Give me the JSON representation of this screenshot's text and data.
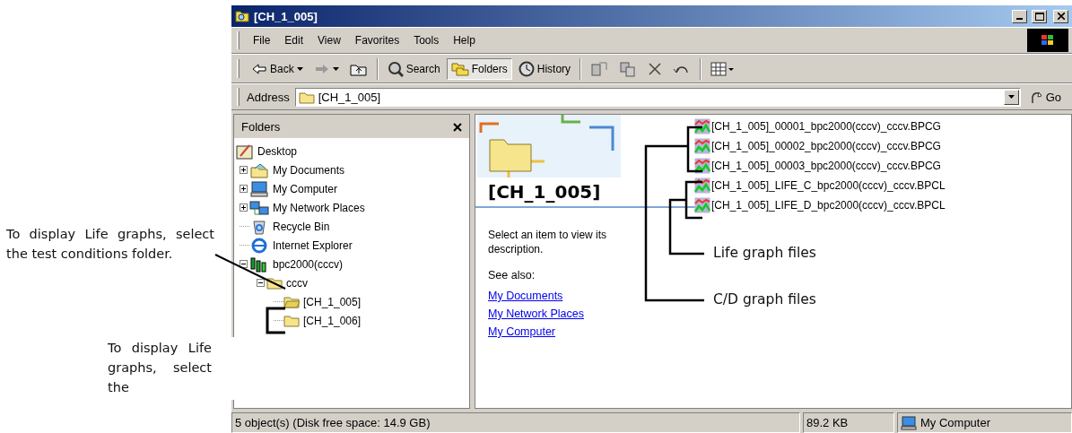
{
  "annotations": {
    "top_note": "To display Life graphs, select the test conditions folder.",
    "lower_note": "To display Life graphs, select the",
    "life_label": "Life graph files",
    "cd_label": "C/D graph files"
  },
  "window": {
    "title": "[CH_1_005]"
  },
  "menu": [
    "File",
    "Edit",
    "View",
    "Favorites",
    "Tools",
    "Help"
  ],
  "toolbar": [
    {
      "kind": "back",
      "label": "Back",
      "pressed": false
    },
    {
      "kind": "forward",
      "pressed": false
    },
    {
      "kind": "up",
      "pressed": false
    },
    {
      "kind": "search",
      "label": "Search",
      "pressed": false
    },
    {
      "kind": "folders",
      "label": "Folders",
      "pressed": true
    },
    {
      "kind": "history",
      "label": "History",
      "pressed": false
    },
    {
      "kind": "move",
      "pressed": false
    },
    {
      "kind": "copy",
      "pressed": false
    },
    {
      "kind": "delete",
      "pressed": false
    },
    {
      "kind": "undo",
      "pressed": false
    },
    {
      "kind": "views",
      "pressed": false
    }
  ],
  "address": {
    "label": "Address",
    "value": "[CH_1_005]",
    "go": "Go"
  },
  "folders_pane": {
    "title": "Folders",
    "tree": [
      {
        "label": "Desktop",
        "kind": "desktop",
        "children": [
          {
            "label": "My Documents",
            "kind": "documents",
            "expanded": false
          },
          {
            "label": "My Computer",
            "kind": "computer",
            "expanded": false
          },
          {
            "label": "My Network Places",
            "kind": "network",
            "expanded": false
          },
          {
            "label": "Recycle Bin",
            "kind": "recycle"
          },
          {
            "label": "Internet Explorer",
            "kind": "browser"
          },
          {
            "label": "bpc2000(cccv)",
            "kind": "app",
            "expanded": true,
            "children": [
              {
                "label": "cccv",
                "kind": "folder",
                "expanded": true,
                "children": [
                  {
                    "label": "[CH_1_005]",
                    "kind": "folder-open"
                  },
                  {
                    "label": "[CH_1_006]",
                    "kind": "folder"
                  }
                ]
              }
            ]
          }
        ]
      }
    ]
  },
  "web_view": {
    "title": "[CH_1_005]",
    "description": "Select an item to view its description.",
    "see_also": "See also:",
    "links": [
      "My Documents",
      "My Network Places",
      "My Computer"
    ]
  },
  "files": [
    {
      "name": "[CH_1_005]_00001_bpc2000(cccv)_cccv.BPCG"
    },
    {
      "name": "[CH_1_005]_00002_bpc2000(cccv)_cccv.BPCG"
    },
    {
      "name": "[CH_1_005]_00003_bpc2000(cccv)_cccv.BPCG"
    },
    {
      "name": "[CH_1_005]_LIFE_C_bpc2000(cccv)_cccv.BPCL"
    },
    {
      "name": "[CH_1_005]_LIFE_D_bpc2000(cccv)_cccv.BPCL"
    }
  ],
  "status_bar": {
    "objects": "5 object(s) (Disk free space: 14.9 GB)",
    "size": "89.2 KB",
    "zone": "My Computer"
  }
}
